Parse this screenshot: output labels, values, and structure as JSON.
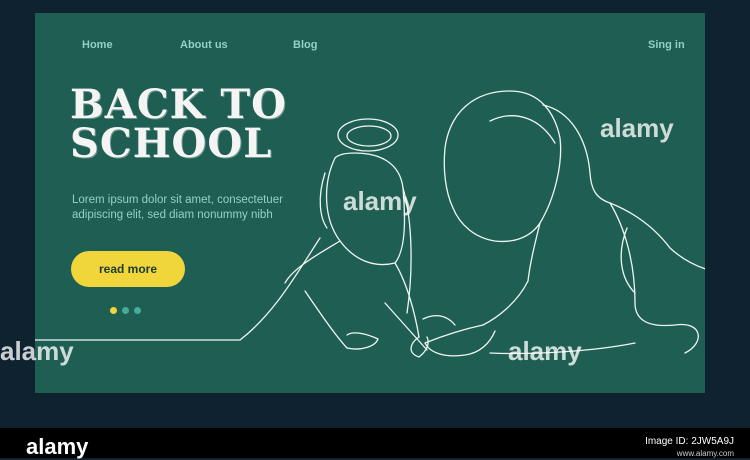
{
  "nav": {
    "home": "Home",
    "about": "About us",
    "blog": "Blog",
    "signin": "Sing in"
  },
  "hero": {
    "title": "BACK TO SCHOOL",
    "description": "Lorem ipsum dolor sit amet, consectetuer adipiscing elit, sed diam nonummy nibh",
    "cta_label": "read more",
    "carousel_active_index": 0,
    "carousel_count": 3
  },
  "colors": {
    "board": "#1f5e52",
    "accent": "#f0d63a",
    "nav_text": "#8fd4c3",
    "frame": "#0f2230"
  },
  "watermark": {
    "text": "alamy",
    "footer_logo": "alamy",
    "image_id": "Image ID: 2JW5A9J",
    "url": "www.alamy.com"
  }
}
